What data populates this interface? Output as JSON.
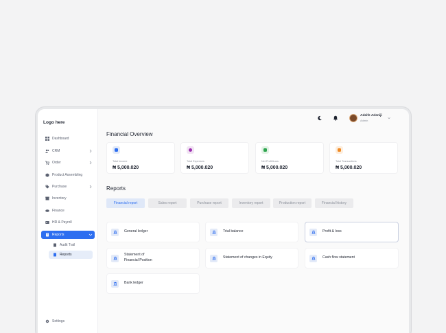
{
  "sidebar": {
    "logo": "Logo here",
    "items": [
      {
        "label": "Dashboard",
        "icon": "grid-icon"
      },
      {
        "label": "CRM",
        "icon": "users-icon",
        "has_chevron": true
      },
      {
        "label": "Order",
        "icon": "cart-icon",
        "has_chevron": true
      },
      {
        "label": "Product Assembling",
        "icon": "cube-icon"
      },
      {
        "label": "Purchase",
        "icon": "tag-icon",
        "has_chevron": true
      },
      {
        "label": "Inventory",
        "icon": "box-icon"
      },
      {
        "label": "Finance",
        "icon": "wallet-icon"
      },
      {
        "label": "HR & Payroll",
        "icon": "id-card-icon"
      },
      {
        "label": "Reports",
        "icon": "report-icon",
        "has_chevron": true,
        "active": true
      }
    ],
    "subitems": [
      {
        "label": "Audit Trail",
        "icon": "document-icon"
      },
      {
        "label": "Reports",
        "icon": "document-icon",
        "current": true
      }
    ],
    "settings": "Settings"
  },
  "topbar": {
    "user_name": "Adeife Adeniji",
    "user_role": "Admin",
    "icons": [
      "moon-icon",
      "bell-icon"
    ]
  },
  "overview": {
    "title": "Financial Overview",
    "cards": [
      {
        "label": "Total Income",
        "value": "₦ 5,000.020",
        "icon_bg": "#e3eaf8",
        "icon_fg": "#2d6ef0"
      },
      {
        "label": "Total Expenses",
        "value": "₦ 5,000.020",
        "icon_bg": "#f1e4f3",
        "icon_fg": "#9c2fb0"
      },
      {
        "label": "Net Profit/Loss",
        "value": "₦ 5,000.020",
        "icon_bg": "#e3f3e6",
        "icon_fg": "#2ea44f"
      },
      {
        "label": "Total Transactions",
        "value": "₦ 5,000.020",
        "icon_bg": "#fdeede",
        "icon_fg": "#f08a24"
      }
    ]
  },
  "reports": {
    "title": "Reports",
    "tabs": [
      "Financial report",
      "Sales report",
      "Purchase report",
      "Inventory report",
      "Production report",
      "Financial history"
    ],
    "active_tab": "Financial report",
    "items": [
      "General ledger",
      "Trial balance",
      "Profit & loss",
      "Statement of\nFinancial Position",
      "Statement of changes in Equity",
      "Cash flow statement",
      "Bank ledger"
    ],
    "selected_item": "Profit & loss"
  },
  "colors": {
    "accent": "#2d6ef0",
    "background": "#f3f3f4",
    "card": "#ffffff"
  }
}
